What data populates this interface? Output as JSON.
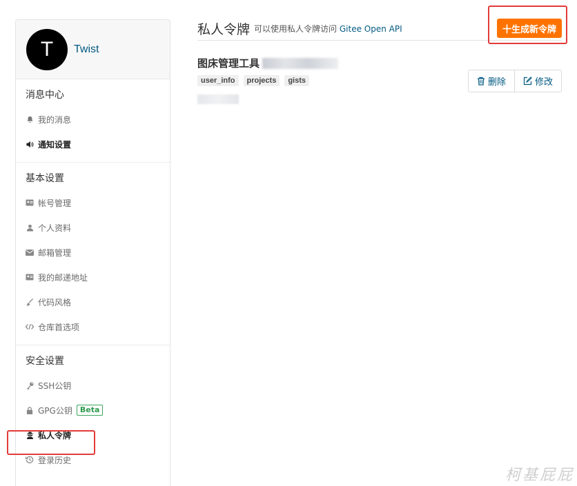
{
  "user": {
    "avatar_letter": "T",
    "name": "Twist"
  },
  "sidebar": {
    "sections": [
      {
        "title": "消息中心",
        "items": [
          {
            "label": "我的消息",
            "icon": "bell-icon"
          },
          {
            "label": "通知设置",
            "icon": "volume-icon"
          }
        ]
      },
      {
        "title": "基本设置",
        "items": [
          {
            "label": "帐号管理",
            "icon": "id-card-icon"
          },
          {
            "label": "个人资料",
            "icon": "user-icon"
          },
          {
            "label": "邮箱管理",
            "icon": "mail-icon"
          },
          {
            "label": "我的邮递地址",
            "icon": "address-card-icon"
          },
          {
            "label": "代码风格",
            "icon": "brush-icon"
          },
          {
            "label": "仓库首选项",
            "icon": "code-icon"
          }
        ]
      },
      {
        "title": "安全设置",
        "items": [
          {
            "label": "SSH公钥",
            "icon": "key-icon"
          },
          {
            "label": "GPG公钥",
            "icon": "lock-icon",
            "badge": "Beta"
          },
          {
            "label": "私人令牌",
            "icon": "spy-icon"
          },
          {
            "label": "登录历史",
            "icon": "history-icon"
          }
        ]
      }
    ]
  },
  "header": {
    "title": "私人令牌",
    "desc_prefix": "可以使用私人令牌访问",
    "desc_link": "Gitee Open API",
    "generate_button": "十生成新令牌"
  },
  "token": {
    "name": "图床管理工具",
    "scopes": [
      "user_info",
      "projects",
      "gists"
    ],
    "delete_label": "删除",
    "edit_label": "修改"
  },
  "watermark": "柯基屁屁",
  "colors": {
    "accent": "#fe7300",
    "link": "#005980",
    "highlight": "#e33a3a"
  }
}
